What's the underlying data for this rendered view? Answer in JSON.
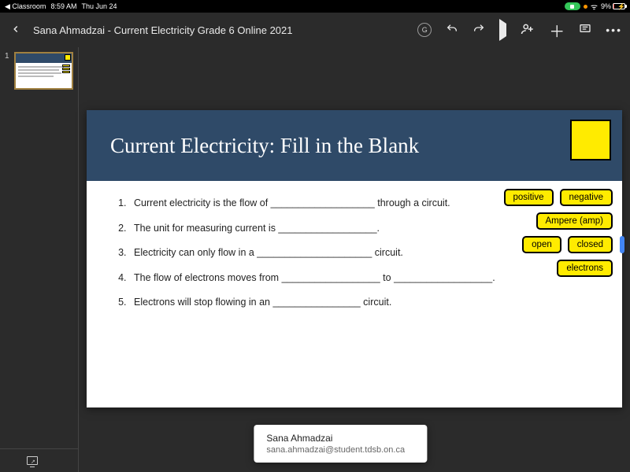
{
  "status": {
    "back_app": "◀ Classroom",
    "time": "8:59 AM",
    "date": "Thu Jun 24",
    "battery_pct": "9%"
  },
  "header": {
    "title": "Sana Ahmadzai - Current Electricity Grade 6 Online 2021",
    "undo": "↶",
    "redo": "↷",
    "share": "＋",
    "more": "⋯",
    "comment": "▤",
    "person_add": "+",
    "g_logo": "G"
  },
  "thumbnails": {
    "first_index": "1"
  },
  "slide": {
    "title": "Current Electricity: Fill in the Blank",
    "questions": [
      "Current electricity is the flow of ___________________ through a circuit.",
      "The unit for measuring current is __________________.",
      "Electricity can only flow in a _____________________ circuit.",
      "The flow of electrons moves from __________________ to __________________.",
      "Electrons will stop flowing in an ________________ circuit."
    ],
    "word_bank": {
      "row1": [
        "positive",
        "negative"
      ],
      "row2": [
        "Ampere (amp)"
      ],
      "row3": [
        "open",
        "closed"
      ],
      "row4": [
        "electrons"
      ]
    }
  },
  "popover": {
    "name": "Sana Ahmadzai",
    "email": "sana.ahmadzai@student.tdsb.on.ca"
  }
}
